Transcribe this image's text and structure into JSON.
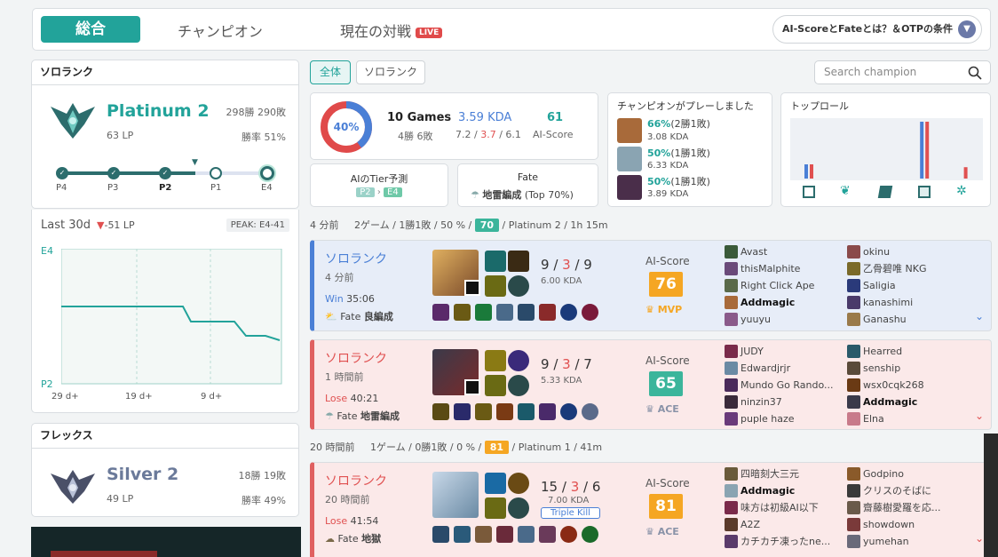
{
  "nav": {
    "tabs": [
      {
        "label": "総合",
        "active": true
      },
      {
        "label": "チャンピオン"
      },
      {
        "label": "現在の対戦",
        "badge": "LIVE"
      }
    ],
    "help_button": "AI-ScoreとFateとは？＆OTPの条件"
  },
  "solo_rank": {
    "title": "ソロランク",
    "tier": "Platinum 2",
    "lp": "63 LP",
    "record": "298勝 290敗",
    "winrate": "勝率 51%",
    "ladder": [
      "P4",
      "P3",
      "P2",
      "P1",
      "E4"
    ]
  },
  "lp_graph": {
    "label": "Last 30d",
    "delta": "-51 LP",
    "peak": "PEAK: E4-41",
    "top_label": "E4",
    "bottom_label": "P2",
    "x_labels": [
      "29 d+",
      "19 d+",
      "9 d+"
    ]
  },
  "flex_rank": {
    "title": "フレックス",
    "tier": "Silver 2",
    "lp": "49 LP",
    "record": "18勝 19敗",
    "winrate": "勝率 49%"
  },
  "filters": {
    "buttons": [
      "全体",
      "ソロランク"
    ],
    "search_placeholder": "Search champion"
  },
  "summary": {
    "winrate_pct": "40%",
    "games": "10 Games",
    "wl": "4勝 6敗",
    "kda": "3.59 KDA",
    "kda_k": "7.2",
    "kda_d": "3.7",
    "kda_a": "6.1",
    "ai_score": "61",
    "ai_score_label": "AI-Score",
    "tier_pred_label": "AIのTier予測",
    "tier_from": "P2",
    "tier_to": "E4",
    "fate_label": "Fate",
    "fate_value": "地雷編成",
    "fate_pct": "(Top 70%)"
  },
  "champ_played": {
    "title": "チャンピオンがプレーしました",
    "rows": [
      {
        "pct": "66%",
        "wl": "(2勝1敗)",
        "kda": "3.08 KDA"
      },
      {
        "pct": "50%",
        "wl": "(1勝1敗)",
        "kda": "6.33 KDA"
      },
      {
        "pct": "50%",
        "wl": "(1勝1敗)",
        "kda": "3.89 KDA"
      }
    ]
  },
  "top_role": {
    "title": "トップロール",
    "roles": [
      "top",
      "jungle",
      "mid",
      "bot",
      "support"
    ],
    "win": [
      0.25,
      0,
      0,
      1.0,
      0
    ],
    "lose": [
      0.25,
      0,
      0,
      1.0,
      0.2
    ]
  },
  "session1": {
    "ago": "4 分前",
    "games": "2ゲーム",
    "wl": "1勝1敗",
    "pct": "50 %",
    "score": "70",
    "tier": "Platinum 2",
    "time": "1h 15m"
  },
  "session2": {
    "ago": "20 時間前",
    "games": "1ゲーム",
    "wl": "0勝1敗",
    "pct": "0 %",
    "score": "81",
    "tier": "Platinum 1",
    "time": "41m"
  },
  "matches": [
    {
      "type": "ソロランク",
      "ago": "4 分前",
      "result": "Win",
      "duration": "35:06",
      "fate": "良編成",
      "k": "9",
      "d": "3",
      "a": "9",
      "kda": "6.00 KDA",
      "ai_label": "AI-Score",
      "score": "76",
      "tag": "MVP",
      "team1": [
        "Avast",
        "thisMalphite",
        "Right Click Ape",
        "Addmagic",
        "yuuyu"
      ],
      "team2": [
        "okinu",
        "乙骨碧唯 NKG",
        "Saligia",
        "kanashimi",
        "Ganashu"
      ]
    },
    {
      "type": "ソロランク",
      "ago": "1 時間前",
      "result": "Lose",
      "duration": "40:21",
      "fate": "地雷編成",
      "k": "9",
      "d": "3",
      "a": "7",
      "kda": "5.33 KDA",
      "ai_label": "AI-Score",
      "score": "65",
      "tag": "ACE",
      "team1": [
        "JUDY",
        "Edwardjrjr",
        "Mundo Go Rando...",
        "ninzin37",
        "puple haze"
      ],
      "team2": [
        "Hearred",
        "senship",
        "wsx0cqk268",
        "Addmagic",
        "Elna"
      ]
    },
    {
      "type": "ソロランク",
      "ago": "20 時間前",
      "result": "Lose",
      "duration": "41:54",
      "fate": "地獄",
      "k": "15",
      "d": "3",
      "a": "6",
      "kda": "7.00 KDA",
      "badge": "Triple Kill",
      "ai_label": "AI-Score",
      "score": "81",
      "tag": "ACE",
      "team1": [
        "四暗刻大三元",
        "Addmagic",
        "味方は初級AI以下",
        "A2Z",
        "カチカチ凍ったne..."
      ],
      "team2": [
        "Godpino",
        "クリスのそばに",
        "齋藤樹愛羅を応...",
        "showdown",
        "yumehan"
      ]
    }
  ],
  "labels": {
    "fate_prefix": "Fate"
  },
  "colors": {
    "accent": "#22a39a",
    "win": "#4a7fd6",
    "lose": "#e05050",
    "score_orange": "#f5a623",
    "score_teal": "#3bb59b"
  }
}
